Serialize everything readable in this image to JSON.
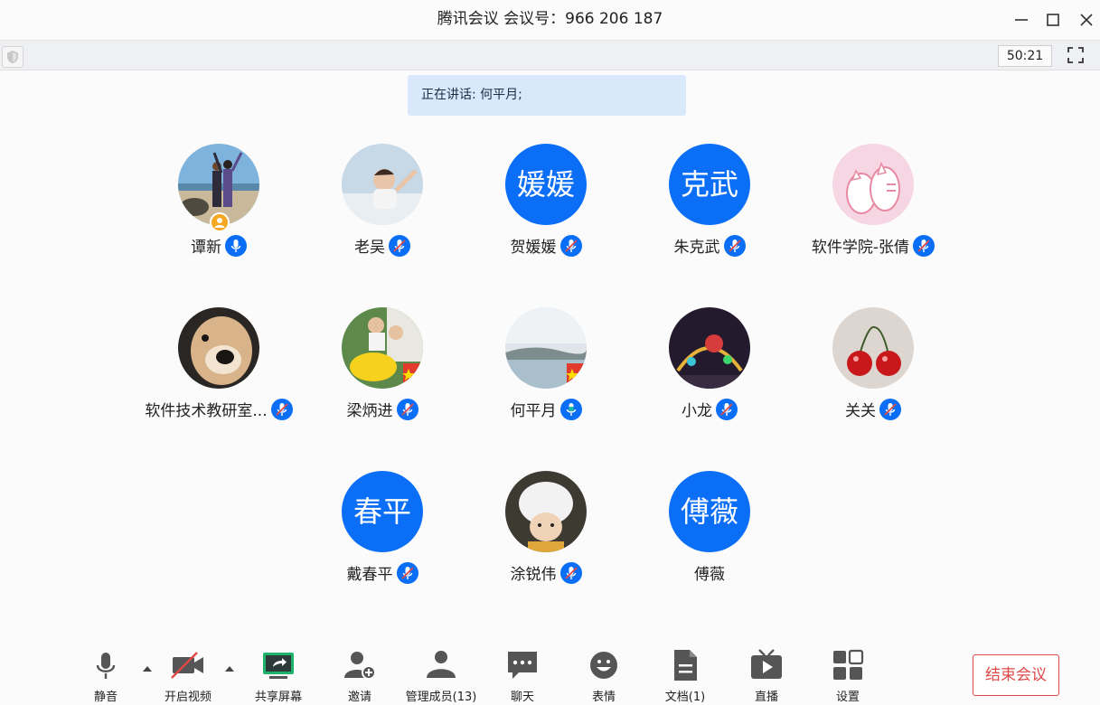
{
  "window": {
    "title": "腾讯会议 会议号：966 206 187"
  },
  "status": {
    "timer": "50:21",
    "speaking": "正在讲话: 何平月;"
  },
  "participants": [
    {
      "name": "谭新",
      "avatar_text": "",
      "mic": "on",
      "host": true
    },
    {
      "name": "老吴",
      "avatar_text": "",
      "mic": "muted"
    },
    {
      "name": "贺媛媛",
      "avatar_text": "媛媛",
      "mic": "muted"
    },
    {
      "name": "朱克武",
      "avatar_text": "克武",
      "mic": "muted"
    },
    {
      "name": "软件学院-张倩",
      "avatar_text": "",
      "mic": "muted"
    },
    {
      "name": "软件技术教研室...",
      "avatar_text": "",
      "mic": "muted"
    },
    {
      "name": "梁炳进",
      "avatar_text": "",
      "mic": "muted"
    },
    {
      "name": "何平月",
      "avatar_text": "",
      "mic": "speaking"
    },
    {
      "name": "小龙",
      "avatar_text": "",
      "mic": "muted"
    },
    {
      "name": "关关",
      "avatar_text": "",
      "mic": "muted"
    },
    {
      "name": "戴春平",
      "avatar_text": "春平",
      "mic": "muted"
    },
    {
      "name": "涂锐伟",
      "avatar_text": "",
      "mic": "muted"
    },
    {
      "name": "傅薇",
      "avatar_text": "傅薇",
      "mic": "none"
    }
  ],
  "toolbar": {
    "mute": "静音",
    "video": "开启视频",
    "share": "共享屏幕",
    "invite": "邀请",
    "members": "管理成员(13)",
    "chat": "聊天",
    "emoji": "表情",
    "docs": "文档(1)",
    "live": "直播",
    "settings": "设置",
    "end": "结束会议"
  },
  "colors": {
    "accent": "#0a6ef6",
    "danger": "#e04848",
    "speaking_bg": "#d9e9fb",
    "speaking_mic": "#18b9a6"
  }
}
